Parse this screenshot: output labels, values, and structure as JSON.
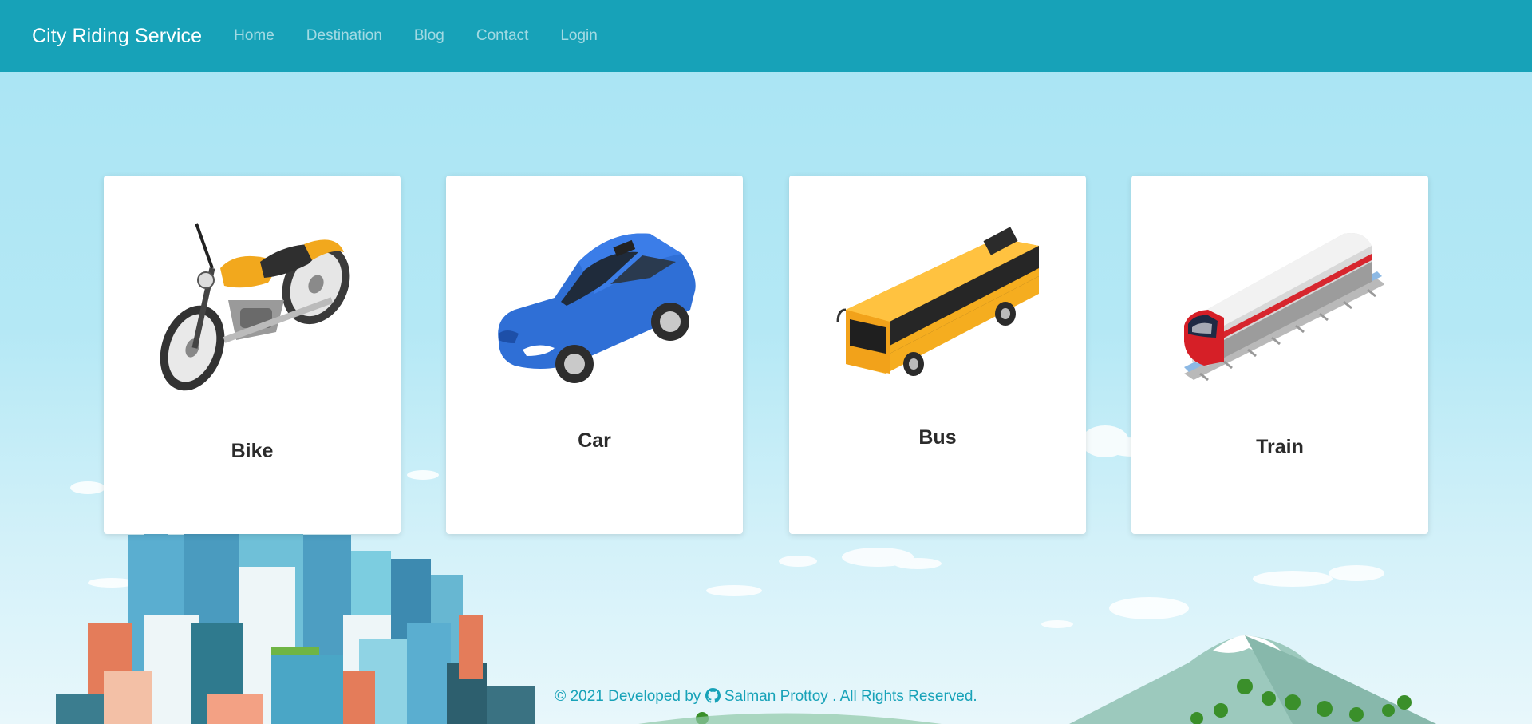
{
  "navbar": {
    "brand": "City Riding Service",
    "links": [
      "Home",
      "Destination",
      "Blog",
      "Contact",
      "Login"
    ]
  },
  "cards": [
    {
      "title": "Bike",
      "icon": "motorcycle-icon"
    },
    {
      "title": "Car",
      "icon": "car-icon"
    },
    {
      "title": "Bus",
      "icon": "bus-icon"
    },
    {
      "title": "Train",
      "icon": "train-icon"
    }
  ],
  "footer": {
    "prefix": "© 2021 Developed by",
    "author": "Salman Prottoy",
    "suffix": ". All Rights Reserved."
  },
  "colors": {
    "navbar": "#17a2b8",
    "sky": "#a8e4f3",
    "footer_text": "#17a2b8"
  }
}
